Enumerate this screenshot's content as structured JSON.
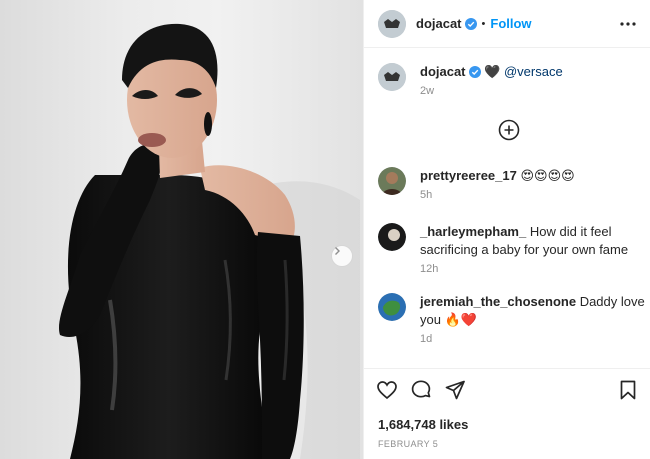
{
  "post": {
    "author": "dojacat",
    "follow_label": "Follow",
    "separator": "•",
    "caption": {
      "username": "dojacat",
      "heart": "🖤",
      "mention": "@versace",
      "time": "2w"
    },
    "comments": [
      {
        "username": "prettyreeree_17",
        "text": "😍😍😍😍",
        "time": "5h"
      },
      {
        "username": "_harleymepham_",
        "text": "How did it feel sacrificing a baby for your own fame",
        "time": "12h"
      },
      {
        "username": "jeremiah_the_chosenone",
        "text": "Daddy love you 🔥❤️",
        "time": "1d"
      }
    ],
    "likes": "1,684,748 likes",
    "date": "FEBRUARY 5"
  },
  "icons": {
    "next": "chevron-right-icon",
    "more": "more-options-icon",
    "verified": "verified-badge-icon",
    "add": "add-circle-icon",
    "like": "heart-icon",
    "comment": "comment-icon",
    "share": "share-icon",
    "save": "bookmark-icon"
  },
  "colors": {
    "link": "#0095f6",
    "mention": "#00376b",
    "muted": "#8e8e8e",
    "text": "#262626",
    "divider": "#efefef"
  }
}
